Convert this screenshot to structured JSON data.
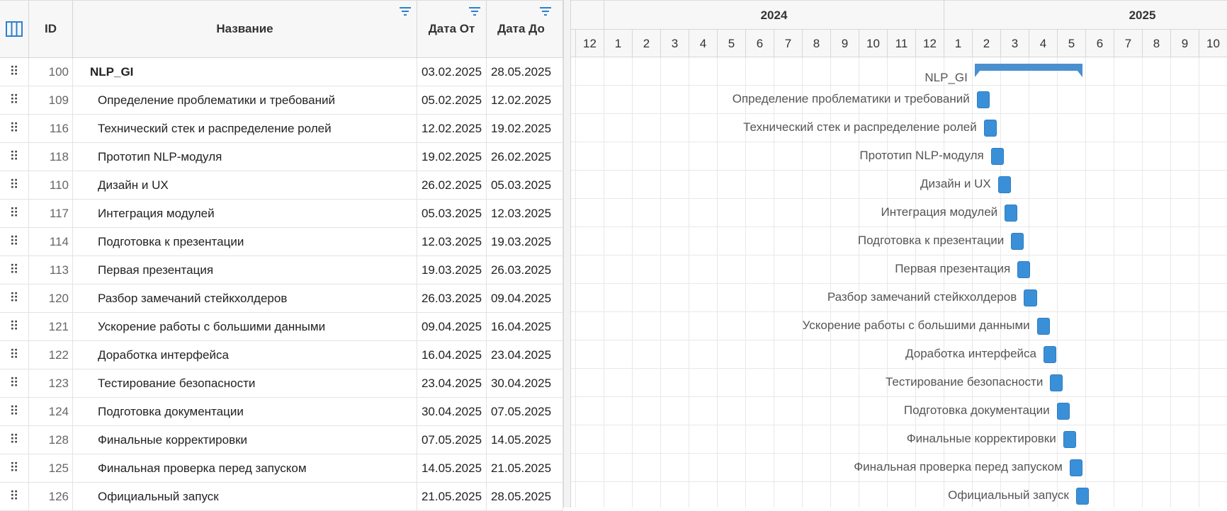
{
  "columns": {
    "id": "ID",
    "name": "Название",
    "from": "Дата От",
    "to": "Дата До"
  },
  "years": [
    "2024",
    "2025"
  ],
  "months": [
    "12",
    "1",
    "2",
    "3",
    "4",
    "5",
    "6",
    "7",
    "8",
    "9",
    "10",
    "11",
    "12",
    "1",
    "2",
    "3",
    "4",
    "5",
    "6",
    "7",
    "8",
    "9",
    "10"
  ],
  "rows": [
    {
      "id": "100",
      "name": "NLP_GI",
      "from": "03.02.2025",
      "to": "28.05.2025",
      "parent": true
    },
    {
      "id": "109",
      "name": "Определение проблематики и требований",
      "from": "05.02.2025",
      "to": "12.02.2025"
    },
    {
      "id": "116",
      "name": "Технический стек и распределение ролей",
      "from": "12.02.2025",
      "to": "19.02.2025"
    },
    {
      "id": "118",
      "name": "Прототип NLP-модуля",
      "from": "19.02.2025",
      "to": "26.02.2025"
    },
    {
      "id": "110",
      "name": "Дизайн и UX",
      "from": "26.02.2025",
      "to": "05.03.2025"
    },
    {
      "id": "117",
      "name": "Интеграция модулей",
      "from": "05.03.2025",
      "to": "12.03.2025"
    },
    {
      "id": "114",
      "name": "Подготовка к презентации",
      "from": "12.03.2025",
      "to": "19.03.2025"
    },
    {
      "id": "113",
      "name": "Первая презентация",
      "from": "19.03.2025",
      "to": "26.03.2025"
    },
    {
      "id": "120",
      "name": "Разбор замечаний стейкхолдеров",
      "from": "26.03.2025",
      "to": "09.04.2025"
    },
    {
      "id": "121",
      "name": "Ускорение работы с большими данными",
      "from": "09.04.2025",
      "to": "16.04.2025"
    },
    {
      "id": "122",
      "name": "Доработка интерфейса",
      "from": "16.04.2025",
      "to": "23.04.2025"
    },
    {
      "id": "123",
      "name": "Тестирование безопасности",
      "from": "23.04.2025",
      "to": "30.04.2025"
    },
    {
      "id": "124",
      "name": "Подготовка документации",
      "from": "30.04.2025",
      "to": "07.05.2025"
    },
    {
      "id": "128",
      "name": "Финальные корректировки",
      "from": "07.05.2025",
      "to": "14.05.2025"
    },
    {
      "id": "125",
      "name": "Финальная проверка перед запуском",
      "from": "14.05.2025",
      "to": "21.05.2025"
    },
    {
      "id": "126",
      "name": "Официальный запуск",
      "from": "21.05.2025",
      "to": "28.05.2025"
    }
  ]
}
